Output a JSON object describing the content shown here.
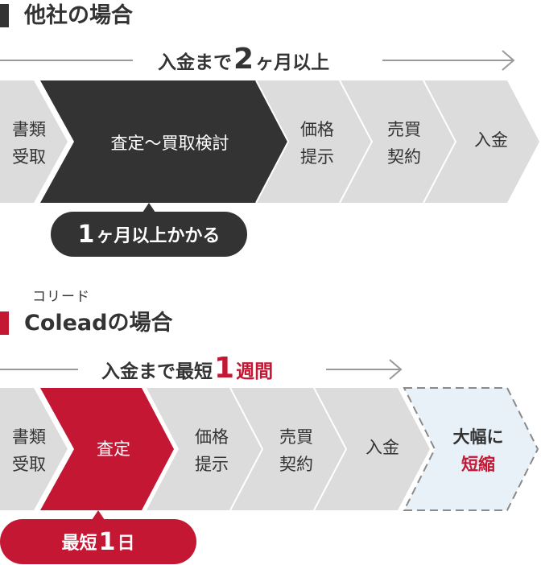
{
  "other": {
    "heading": "他社の場合",
    "duration_pre": "入金まで",
    "duration_num": "2",
    "duration_post": "ヶ月以上",
    "steps": [
      "書類\n受取",
      "査定〜買取検討",
      "価格\n提示",
      "売買\n契約",
      "入金"
    ],
    "callout_num": "1",
    "callout_text": "ヶ月以上かかる"
  },
  "colead": {
    "ruby": "コリード",
    "heading": "Coleadの場合",
    "duration_pre": "入金まで最短",
    "duration_num": "1",
    "duration_post": "週間",
    "steps": [
      "書類\n受取",
      "査定",
      "価格\n提示",
      "売買\n契約",
      "入金"
    ],
    "highlight_line1": "大幅に",
    "highlight_line2": "短縮",
    "callout_pre": "最短",
    "callout_num": "1",
    "callout_post": "日"
  },
  "colors": {
    "dark": "#333333",
    "red": "#c41734",
    "step_gray": "#dcdcdc",
    "highlight_bg": "#e8f0f8",
    "dash": "#8a8a8a",
    "arrow_line": "#999999"
  }
}
